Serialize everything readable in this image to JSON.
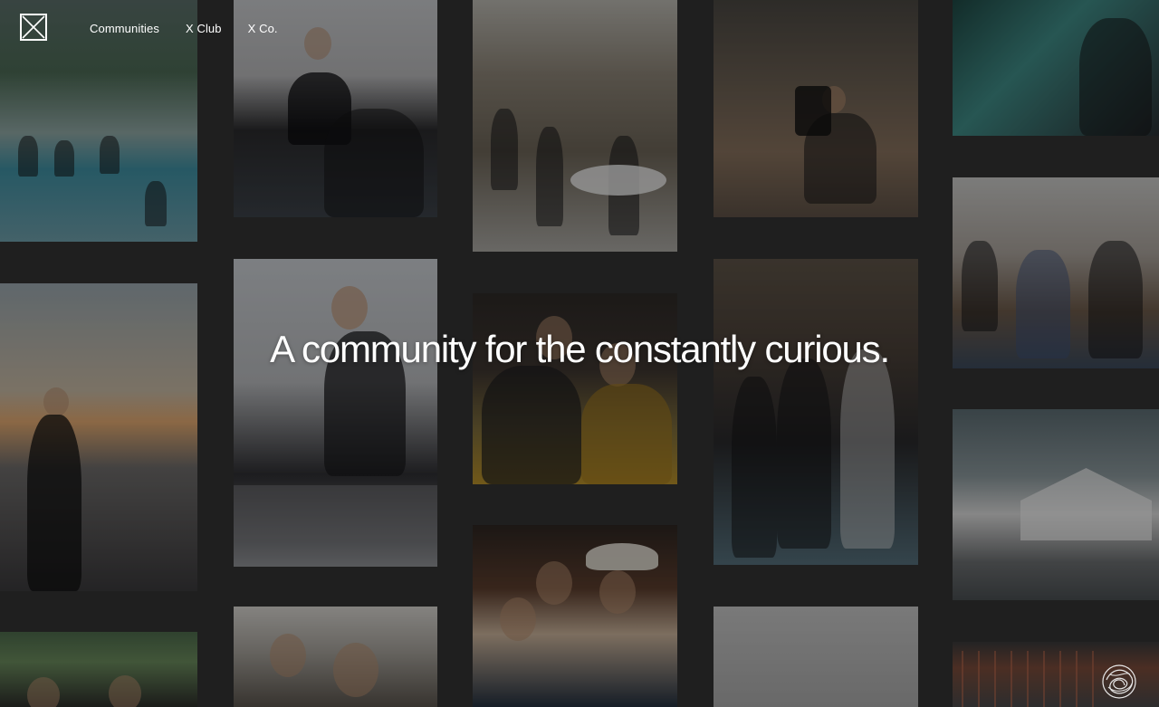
{
  "nav": {
    "logo_icon": "x-box-logo-icon",
    "items": [
      {
        "label": "Communities"
      },
      {
        "label": "X Club"
      },
      {
        "label": "X Co."
      }
    ]
  },
  "hero": {
    "headline": "A community for the constantly curious."
  },
  "gallery": {
    "tiles": [
      {
        "name": "photo-rooftop-pool"
      },
      {
        "name": "photo-dj-performer"
      },
      {
        "name": "photo-crowd-event"
      },
      {
        "name": "photo-sound-bath"
      },
      {
        "name": "photo-neon-artist"
      },
      {
        "name": "photo-sunset-balcony"
      },
      {
        "name": "photo-singer-mic"
      },
      {
        "name": "photo-couple-portrait"
      },
      {
        "name": "photo-party-lights"
      },
      {
        "name": "photo-lounge-audience"
      },
      {
        "name": "photo-tent-rooftop"
      },
      {
        "name": "photo-group-cowboy-hat"
      },
      {
        "name": "photo-mixer-crowd"
      },
      {
        "name": "photo-greenery-crowd"
      },
      {
        "name": "photo-grey-sky"
      },
      {
        "name": "photo-rooftop-railing"
      }
    ]
  },
  "badge_icon": "scribble-circle-icon"
}
